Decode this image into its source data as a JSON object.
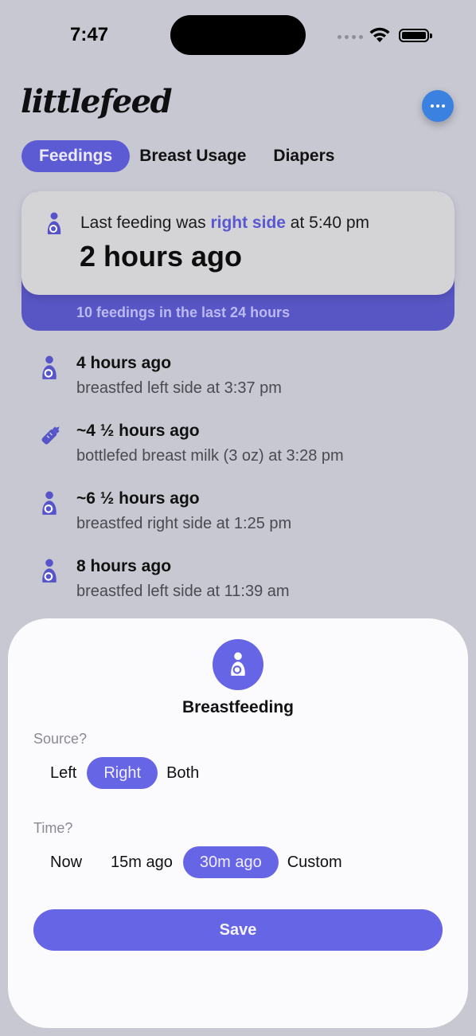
{
  "status_bar": {
    "time": "7:47"
  },
  "app": {
    "logo_text": "littlefeed"
  },
  "tabs": [
    {
      "label": "Feedings",
      "active": true
    },
    {
      "label": "Breast Usage",
      "active": false
    },
    {
      "label": "Diapers",
      "active": false
    }
  ],
  "summary": {
    "prefix": "Last feeding was ",
    "highlight": "right side",
    "suffix": " at 5:40 pm",
    "elapsed": "2 hours ago",
    "count_text": "10 feedings in the last 24 hours"
  },
  "feedings": [
    {
      "icon": "breastfeeding-icon",
      "title": "4 hours ago",
      "detail": "breastfed left side at 3:37 pm"
    },
    {
      "icon": "bottle-icon",
      "title": "~4 ½ hours ago",
      "detail": "bottlefed breast milk (3 oz) at 3:28 pm"
    },
    {
      "icon": "breastfeeding-icon",
      "title": "~6 ½ hours ago",
      "detail": "breastfed right side at 1:25 pm"
    },
    {
      "icon": "breastfeeding-icon",
      "title": "8 hours ago",
      "detail": "breastfed left side at 11:39 am"
    }
  ],
  "sheet": {
    "title": "Breastfeeding",
    "source_label": "Source?",
    "source_options": [
      {
        "label": "Left",
        "selected": false
      },
      {
        "label": "Right",
        "selected": true
      },
      {
        "label": "Both",
        "selected": false
      }
    ],
    "time_label": "Time?",
    "time_options": [
      {
        "label": "Now",
        "selected": false
      },
      {
        "label": "15m ago",
        "selected": false
      },
      {
        "label": "30m ago",
        "selected": true
      },
      {
        "label": "Custom",
        "selected": false
      }
    ],
    "save_label": "Save"
  },
  "colors": {
    "accent": "#6665e6",
    "accent_dark": "#5856c4",
    "more_button": "#3b82e0",
    "background": "#c8c8d3",
    "icon": "#5654c8"
  }
}
